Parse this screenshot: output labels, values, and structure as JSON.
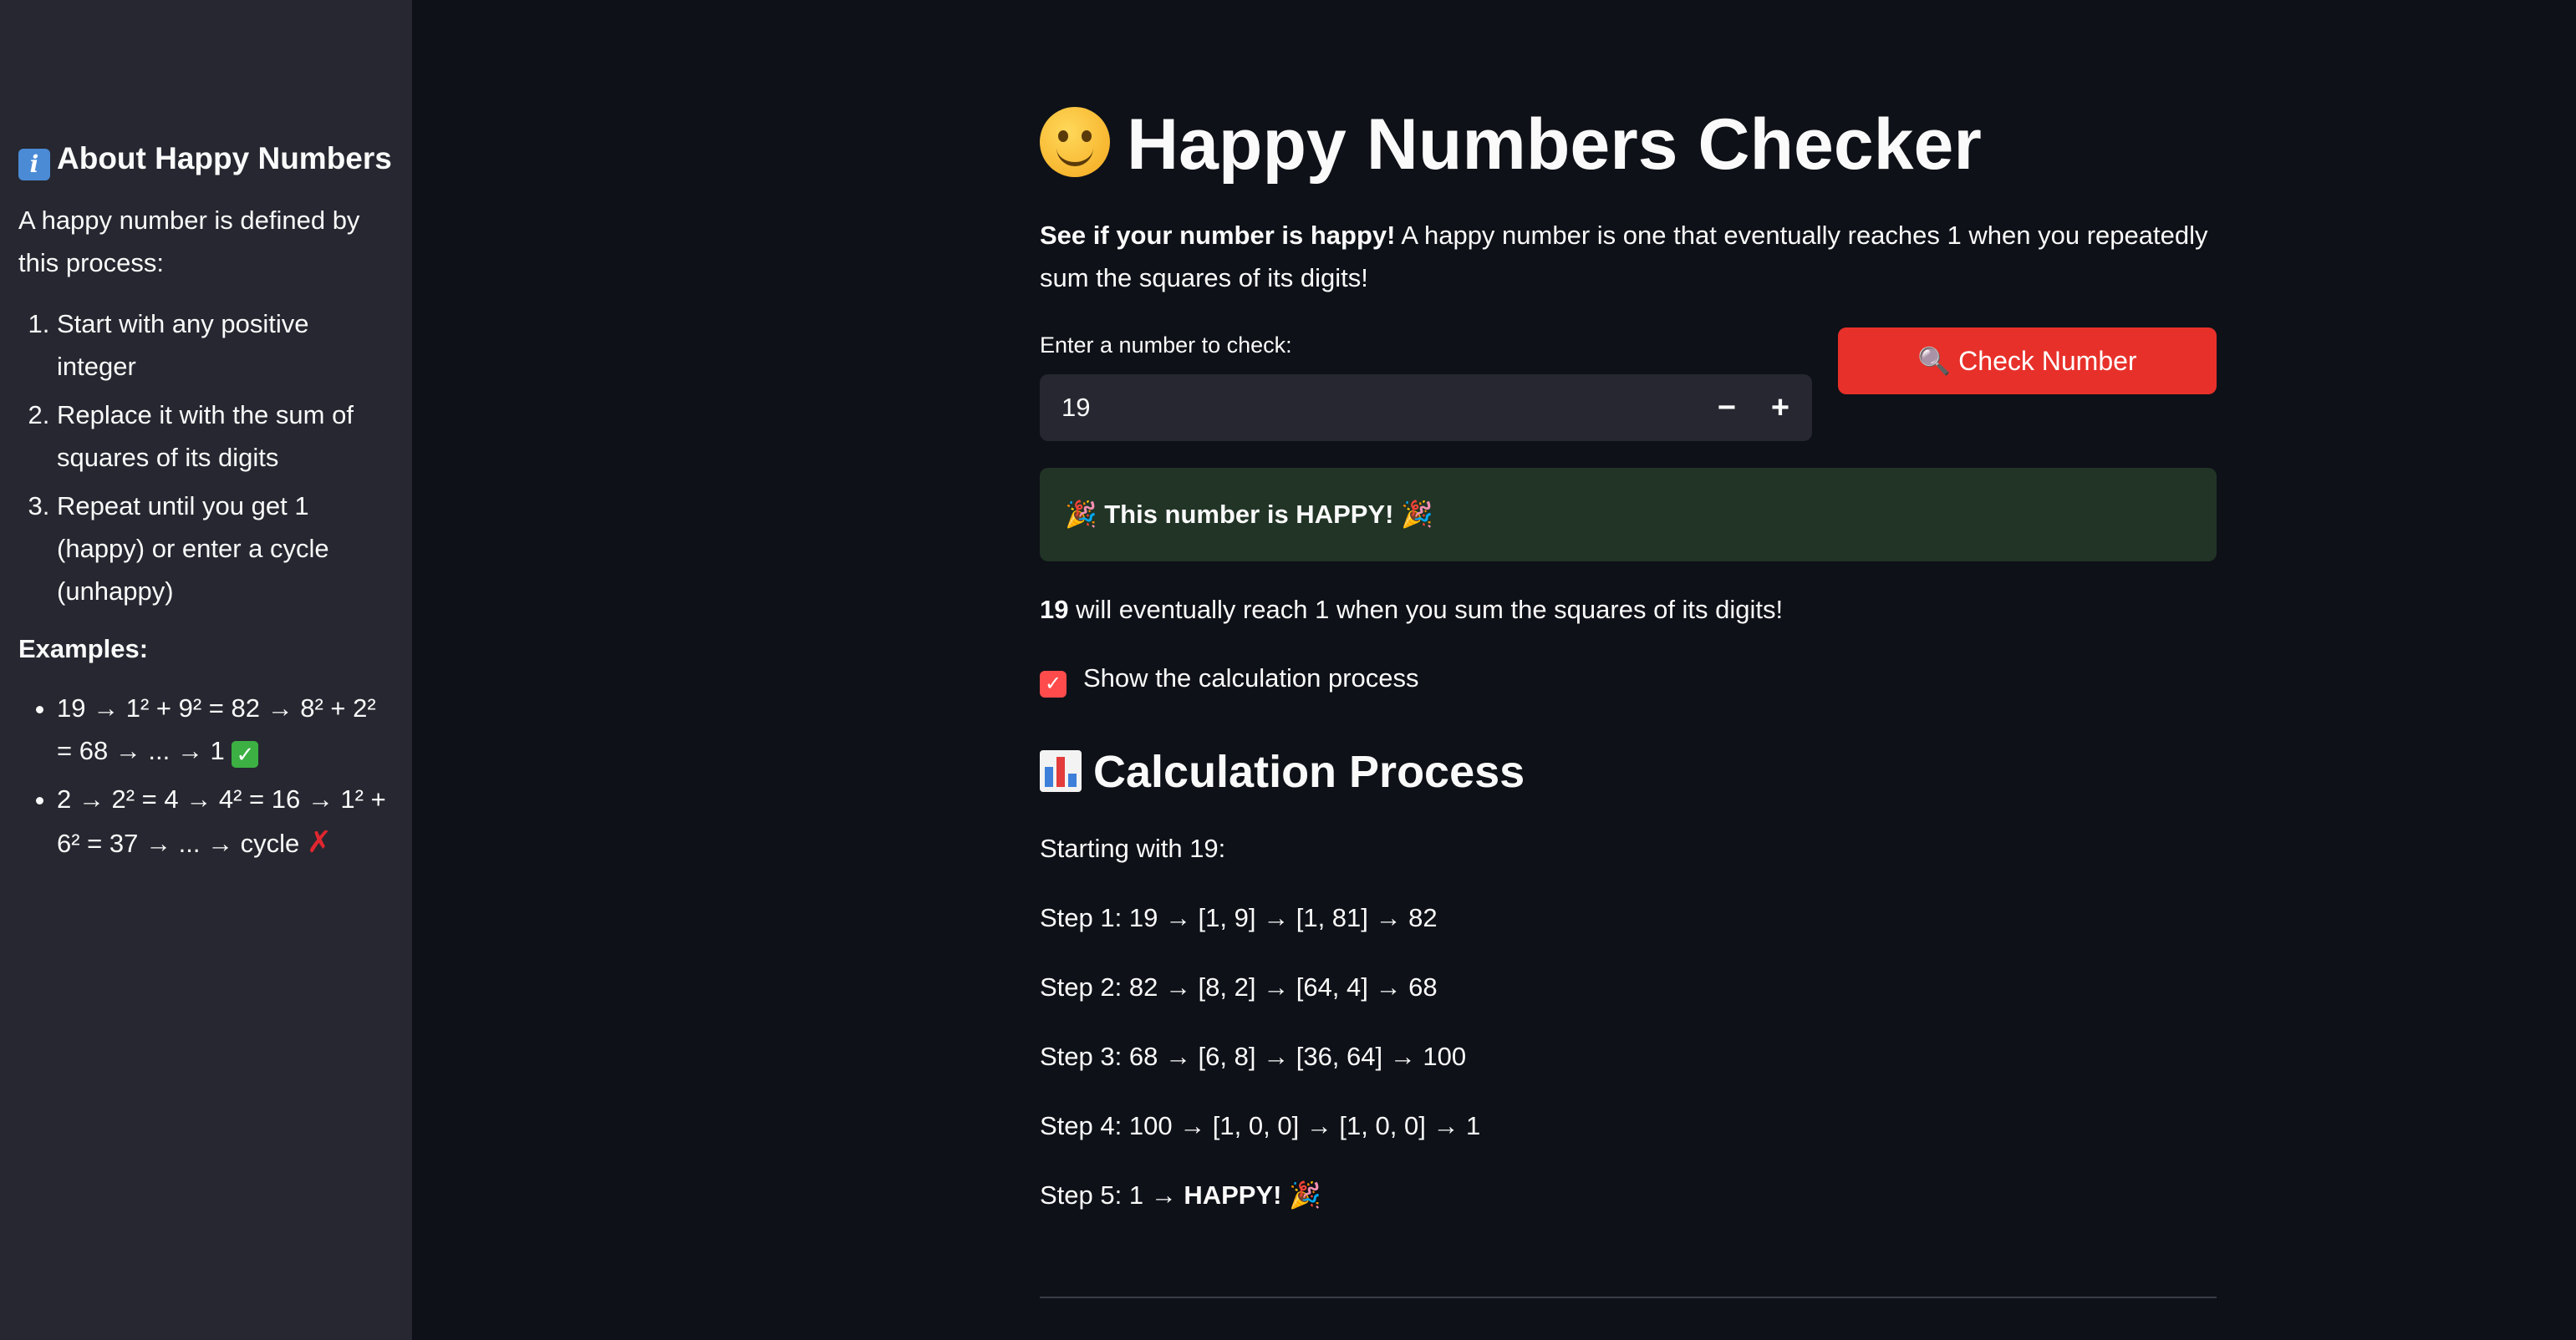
{
  "sidebar": {
    "title": "About Happy Numbers",
    "intro": "A happy number is defined by this process:",
    "steps": [
      "Start with any positive integer",
      "Replace it with the sum of squares of its digits",
      "Repeat until you get 1 (happy) or enter a cycle (unhappy)"
    ],
    "examples_label": "Examples:",
    "examples": [
      "19 → 1² + 9² = 82 → 8² + 2² = 68 → ... → 1",
      "2 → 2² = 4 → 4² = 16 → 1² + 6² = 37 → ... → cycle"
    ]
  },
  "main": {
    "title": "Happy Numbers Checker",
    "description_bold": "See if your number is happy!",
    "description_rest": " A happy number is one that eventually reaches 1 when you repeatedly sum the squares of its digits!",
    "input_label": "Enter a number to check:",
    "input_value": "19",
    "minus_label": "−",
    "plus_label": "+",
    "check_button": "🔍 Check Number",
    "success_message": "🎉 This number is HAPPY! 🎉",
    "result_number": "19",
    "result_text": " will eventually reach 1 when you sum the squares of its digits!",
    "checkbox_label": "Show the calculation process",
    "checkbox_checked": true,
    "section_title": "Calculation Process",
    "starting": "Starting with 19:",
    "steps": [
      "Step 1: 19 → [1, 9] → [1, 81] → 82",
      "Step 2: 82 → [8, 2] → [64, 4] → 68",
      "Step 3: 68 → [6, 8] → [36, 64] → 100",
      "Step 4: 100 → [1, 0, 0] → [1, 0, 0] → 1"
    ],
    "last_step_prefix": "Step 5: 1 → ",
    "last_step_bold": "HAPPY!",
    "last_step_suffix": " 🎉"
  },
  "colors": {
    "background": "#0e1117",
    "sidebar": "#262730",
    "primary_button": "#e8302a",
    "success_bg": "#213426",
    "checkbox": "#ff4b4b"
  }
}
